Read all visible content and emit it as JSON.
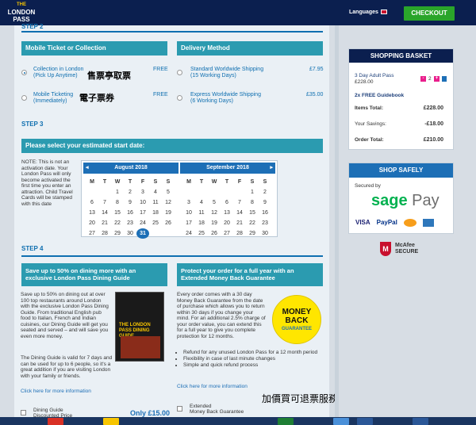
{
  "header": {
    "logo_line1": "THE",
    "logo_line2": "LONDON",
    "logo_line3": "PASS",
    "languages": "Languages",
    "checkout": "CHECKOUT"
  },
  "step2": {
    "label": "STEP 2",
    "ticket_header": "Mobile Ticket or Collection",
    "delivery_header": "Delivery Method",
    "options": [
      {
        "title": "Collection in London",
        "sub": "(Pick Up Anytime)",
        "price": "FREE",
        "cjk": "售票亭取票",
        "selected": true
      },
      {
        "title": "Mobile Ticketing",
        "sub": "(Immediately)",
        "price": "FREE",
        "cjk": "電子票券",
        "selected": false
      }
    ],
    "delivery": [
      {
        "title": "Standard Worldwide Shipping",
        "sub": "(15 Working Days)",
        "price": "£7.95"
      },
      {
        "title": "Express Worldwide Shipping",
        "sub": "(6 Working Days)",
        "price": "£35.00"
      }
    ]
  },
  "step3": {
    "label": "STEP 3",
    "header": "Please select your estimated start date:",
    "note": "NOTE: This is not an activation date. Your London Pass will only become activated the first time you enter an attraction. Child Travel Cards will be stamped with this date",
    "cal1": {
      "title": "August 2018",
      "days": [
        "M",
        "T",
        "W",
        "T",
        "F",
        "S",
        "S"
      ],
      "cells": [
        "",
        "",
        "1",
        "2",
        "3",
        "4",
        "5",
        "6",
        "7",
        "8",
        "9",
        "10",
        "11",
        "12",
        "13",
        "14",
        "15",
        "16",
        "17",
        "18",
        "19",
        "20",
        "21",
        "22",
        "23",
        "24",
        "25",
        "26",
        "27",
        "28",
        "29",
        "30",
        "31",
        "",
        ""
      ],
      "today": "31"
    },
    "cal2": {
      "title": "September 2018",
      "days": [
        "M",
        "T",
        "W",
        "T",
        "F",
        "S",
        "S"
      ],
      "cells": [
        "",
        "",
        "",
        "",
        "",
        "1",
        "2",
        "3",
        "4",
        "5",
        "6",
        "7",
        "8",
        "9",
        "10",
        "11",
        "12",
        "13",
        "14",
        "15",
        "16",
        "17",
        "18",
        "19",
        "20",
        "21",
        "22",
        "23",
        "24",
        "25",
        "26",
        "27",
        "28",
        "29",
        "30"
      ]
    }
  },
  "step4": {
    "label": "STEP 4",
    "dining": {
      "header": "Save up to 50% on dining more with an exclusive London Pass Dining Guide",
      "body1": "Save up to 50% on dining out at over 100 top restaurants around London with the exclusive London Pass Dining Guide. From traditional English pub food to Italian, French and Indian cuisines, our Dining Guide will get you seated and served – and will save you even more money.",
      "body2": "The Dining Guide is valid for 7 days and can be used for up to 6 people, so it's a great addition if you are visiting London with your family or friends.",
      "link": "Click here for more information",
      "book_title": "THE LONDON PASS DINING GUIDE",
      "checkbox": "Dining Guide",
      "checkbox_sub": "Discounted Price",
      "price": "Only £15.00"
    },
    "guarantee": {
      "header": "Protect your order for a full year with an Extended Money Back Guarantee",
      "body": "Every order comes with a 30 day Money Back Guarantee from the date of purchase which allows you to return within 30 days if you change your mind. For an additional 2.5% charge of your order value, you can extend this for a full year to give you complete protection for 12 months.",
      "badge1": "MONEY",
      "badge2": "BACK",
      "badge3": "GUARANTEE",
      "bullets": [
        "Refund for any unused London Pass for a 12 month period",
        "Flexibility in case of last minute changes",
        "Simple and quick refund process"
      ],
      "link": "Click here for more information",
      "checkbox": "Extended",
      "checkbox_sub": "Money Back Guarantee",
      "cjk": "加價買可退票服務"
    }
  },
  "basket": {
    "title": "SHOPPING BASKET",
    "item": "3 Day Adult Pass",
    "item_price": "£228.00",
    "qty": "2",
    "free": "2x FREE Guidebook",
    "items_total_label": "Items Total:",
    "items_total": "£228.00",
    "savings_label": "Your Savings:",
    "savings": "-£18.00",
    "order_total_label": "Order Total:",
    "order_total": "£210.00"
  },
  "safe": {
    "title": "SHOP SAFELY",
    "secured": "Secured by",
    "sage": "sage",
    "pay": "Pay",
    "visa": "VISA",
    "paypal": "PayPal",
    "mcafee1": "McAfee",
    "mcafee2": "SECURE"
  }
}
